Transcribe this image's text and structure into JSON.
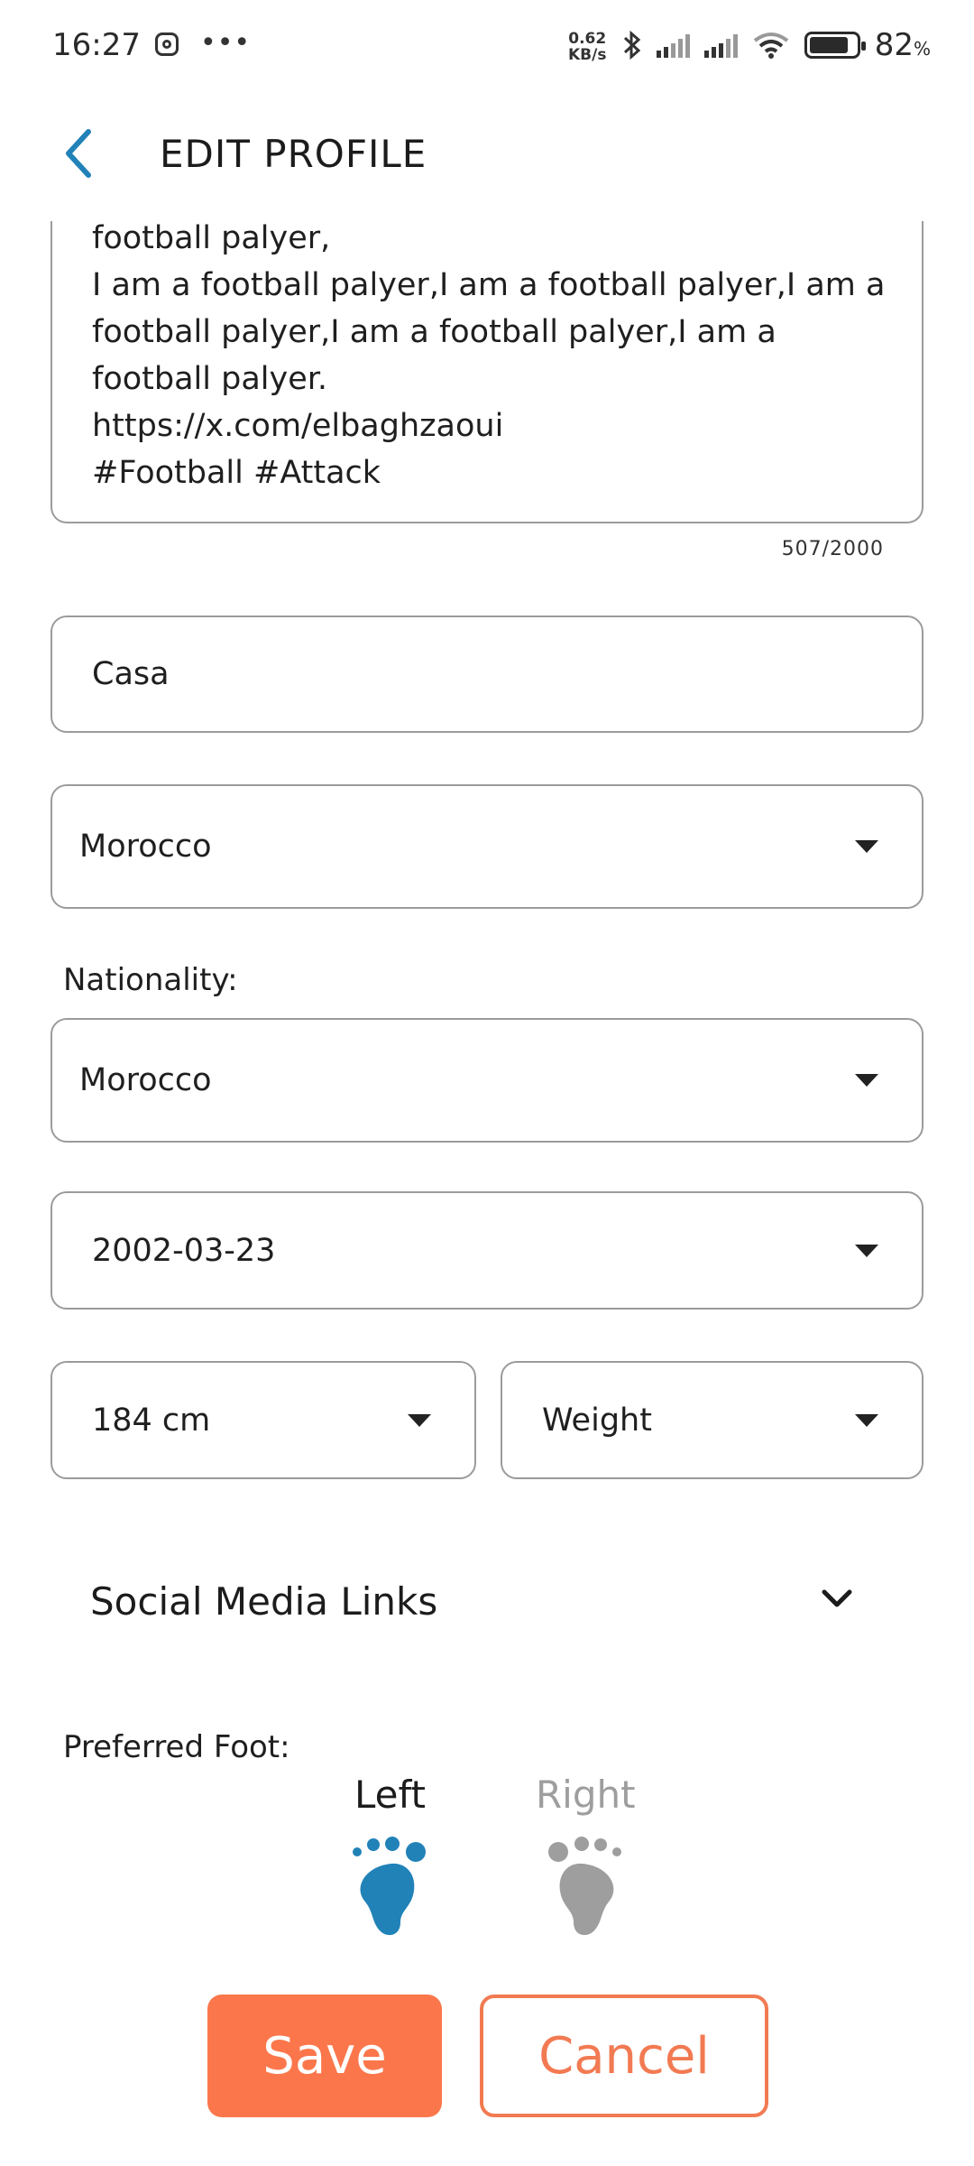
{
  "status_bar": {
    "time": "16:27",
    "speed_value": "0.62",
    "speed_unit": "KB/s",
    "battery_percent": "82",
    "battery_suffix": "%"
  },
  "header": {
    "title": "EDIT PROFILE",
    "back_icon": "chevron-left-icon",
    "accent_color": "#2182b8"
  },
  "bio": {
    "text": "football palyer,\nI am a football palyer,I am a football palyer,I am a football palyer,I am a football palyer,I am a football palyer.\nhttps://x.com/elbaghzaoui\n#Football #Attack",
    "counter": "507/2000"
  },
  "fields": {
    "city": "Casa",
    "country": "Morocco",
    "nationality_label": "Nationality:",
    "nationality": "Morocco",
    "birth_date": "2002-03-23",
    "height": "184 cm",
    "weight_placeholder": "Weight"
  },
  "social": {
    "label": "Social Media Links",
    "icon": "chevron-down-icon"
  },
  "preferred_foot": {
    "label": "Preferred Foot:",
    "left": "Left",
    "right": "Right",
    "selected": "Left",
    "selected_color": "#2182b8",
    "unselected_color": "#9e9e9e"
  },
  "actions": {
    "save": "Save",
    "cancel": "Cancel",
    "primary_color": "#fb774b"
  }
}
